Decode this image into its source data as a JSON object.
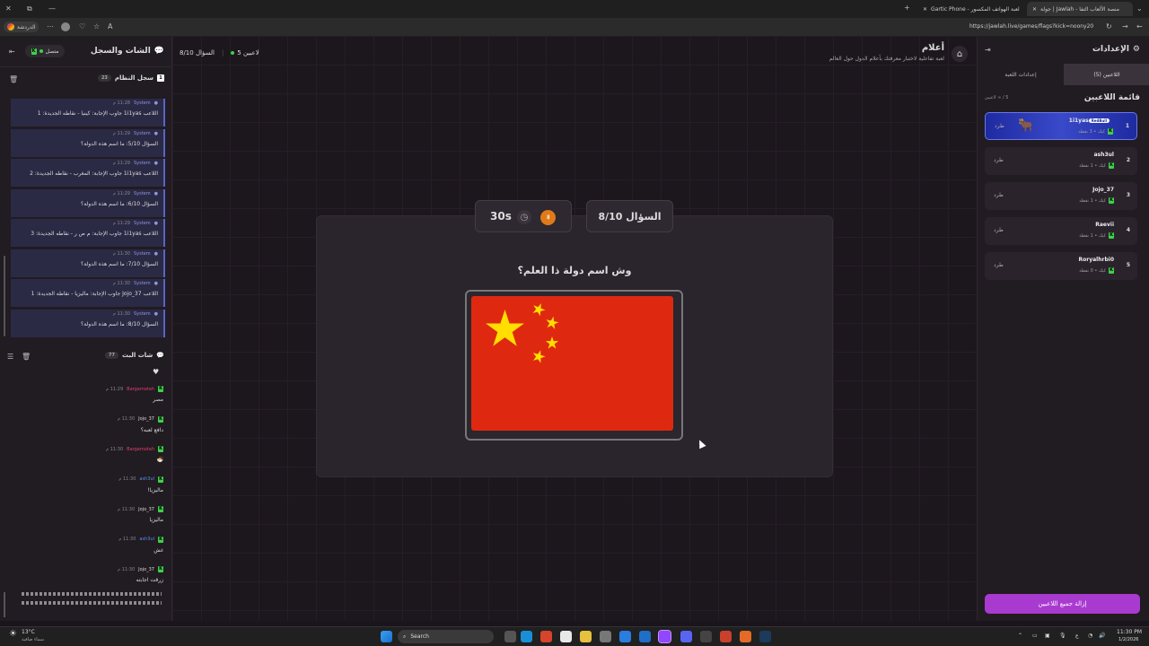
{
  "browser": {
    "tabs": [
      {
        "label": "Gartic Phone - لعبة الهواتف المكسور"
      },
      {
        "label": "جولة | Jawlah - منصة الألعاب التفا"
      }
    ],
    "url": "https://jawlah.live/games/flags?kick=noony20",
    "profile_label": "الدردشة"
  },
  "left_panel": {
    "title": "الشات والسجل",
    "status": "متصل",
    "system_log": {
      "title": "سجل النظام",
      "count": "23",
      "messages": [
        {
          "sender": "System",
          "time": "11:28 م",
          "text": "اللاعب 1i1yas جاوب الإجابة: كينيا - نقاطه الجديدة: 1"
        },
        {
          "sender": "System",
          "time": "11:29 م",
          "text": "السؤال 5/10: ما اسم هذه الدولة؟"
        },
        {
          "sender": "System",
          "time": "11:29 م",
          "text": "اللاعب 1i1yas جاوب الإجابة: المغرب - نقاطه الجديدة: 2"
        },
        {
          "sender": "System",
          "time": "11:29 م",
          "text": "السؤال 6/10: ما اسم هذه الدولة؟"
        },
        {
          "sender": "System",
          "time": "11:29 م",
          "text": "اللاعب 1i1yas جاوب الإجابة: م ص ر - نقاطه الجديدة: 3"
        },
        {
          "sender": "System",
          "time": "11:30 م",
          "text": "السؤال 7/10: ما اسم هذه الدولة؟"
        },
        {
          "sender": "System",
          "time": "11:30 م",
          "text": "اللاعب Jojo_37 جاوب الإجابة: ماليزيا - نقاطه الجديدة: 1"
        },
        {
          "sender": "System",
          "time": "11:30 م",
          "text": "السؤال 8/10: ما اسم هذه الدولة؟"
        }
      ]
    },
    "stream_chat": {
      "title": "شات البث",
      "count": "77",
      "messages": [
        {
          "user": "Bargamotah",
          "time": "11:29 م",
          "text": "مصر",
          "color": "#e0406a"
        },
        {
          "user": "Jojo_37",
          "time": "11:30 م",
          "text": "دافع لعبه؟",
          "color": "#dddddd"
        },
        {
          "user": "Bargamotah",
          "time": "11:30 م",
          "text": "🍜",
          "color": "#e0406a"
        },
        {
          "user": "ash3ul",
          "time": "11:30 م",
          "text": "ماليزيا!",
          "color": "#5b8fe0"
        },
        {
          "user": "Jojo_37",
          "time": "11:30 م",
          "text": "ماليزيا",
          "color": "#dddddd"
        },
        {
          "user": "ash3ul",
          "time": "11:30 م",
          "text": "غش",
          "color": "#5b8fe0"
        },
        {
          "user": "Jojo_37",
          "time": "11:30 م",
          "text": "زرقت اجابته",
          "color": "#dddddd"
        }
      ]
    }
  },
  "header": {
    "title": "أعلام",
    "subtitle": "لعبة تفاعلية لاختبار معرفتك بأعلام الدول حول العالم",
    "players_online": "5 لاعبين",
    "question_progress": "السؤال 8/10"
  },
  "game": {
    "question_counter": "السؤال 8/10",
    "timer": "30s",
    "question": "وش اسم دولة ذا العلم؟",
    "flag": {
      "name": "china-flag",
      "background": "#de2910",
      "stars": "#ffde00"
    }
  },
  "right_panel": {
    "title": "الإعدادات",
    "tabs": [
      {
        "label": "اللاعبين (5)",
        "active": true
      },
      {
        "label": "إعدادات اللعبة",
        "active": false
      }
    ],
    "list_title": "قائمة اللاعبين",
    "list_count": "5 / ∞ لاعبين",
    "kick_label": "طرد",
    "players": [
      {
        "rank": "1",
        "name": "1i1yas",
        "badge": "RedBull",
        "score": "كيك • 3 نقطة"
      },
      {
        "rank": "2",
        "name": "ash3ul",
        "score": "كيك • 1 نقطة"
      },
      {
        "rank": "3",
        "name": "Jojo_37",
        "score": "كيك • 1 نقطة"
      },
      {
        "rank": "4",
        "name": "Raevii",
        "score": "كيك • 1 نقطة"
      },
      {
        "rank": "5",
        "name": "Roryalhrbi0",
        "score": "كيك • 0 نقطة"
      }
    ],
    "remove_all_label": "إزالة جميع اللاعبين"
  },
  "taskbar": {
    "weather_temp": "13°C",
    "weather_text": "سماء صافية",
    "search_label": "Search",
    "lang": "ع",
    "time": "11:30 PM",
    "date": "1/2/2026"
  },
  "colors": {
    "accent": "#a93ad0",
    "brand_green": "#3ed14a",
    "system_blue": "#5b63c9"
  }
}
